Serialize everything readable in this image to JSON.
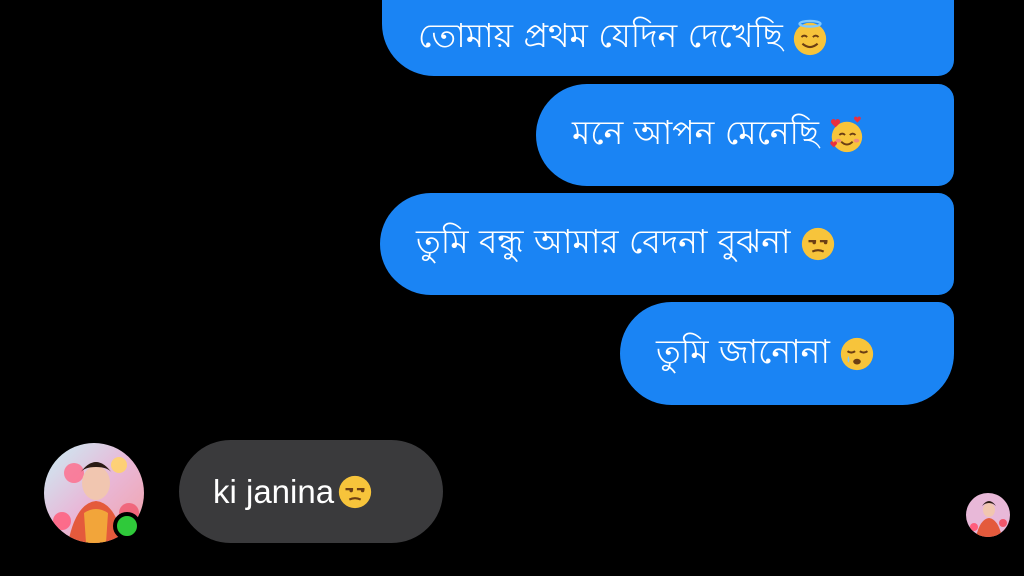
{
  "messages": {
    "outgoing": [
      {
        "text": "তোমায় প্রথম যেদিন দেখেছি",
        "emoji": "smiling-face-with-halo"
      },
      {
        "text": "মনে আপন মেনেছি",
        "emoji": "smiling-face-with-hearts"
      },
      {
        "text": "তুমি বন্ধু আমার বেদনা বুঝনা",
        "emoji": "unamused-face"
      },
      {
        "text": "তুমি জানোনা",
        "emoji": "sleepy-face"
      }
    ],
    "incoming": [
      {
        "text": "ki janina",
        "emoji": "unamused-face"
      }
    ]
  },
  "contact": {
    "avatar": "contact-avatar",
    "online": true
  },
  "colors": {
    "outgoing_bubble": "#1a84f4",
    "incoming_bubble": "#3a3a3c",
    "online": "#2fc93a",
    "background": "#000000"
  }
}
